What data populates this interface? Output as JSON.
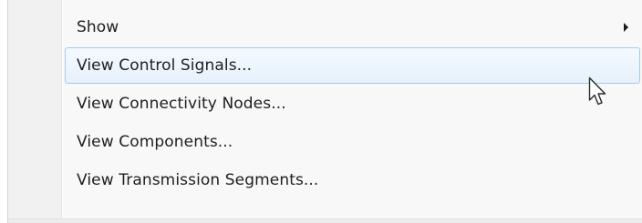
{
  "context_menu": {
    "items": [
      {
        "label": "Show",
        "has_submenu": true
      },
      {
        "label": "View Control Signals...",
        "highlighted": true
      },
      {
        "label": "View Connectivity Nodes..."
      },
      {
        "label": "View Components..."
      },
      {
        "label": "View Transmission Segments..."
      }
    ]
  },
  "icons": {
    "submenu": "chevron-right-icon",
    "cursor": "mouse-pointer-icon"
  },
  "colors": {
    "menu_background": "#f8f8f8",
    "gutter_background": "#f1f1f1",
    "highlight_border": "#a8c8ec",
    "highlight_fill": "#e6f1fc",
    "text": "#1e1e1e"
  }
}
